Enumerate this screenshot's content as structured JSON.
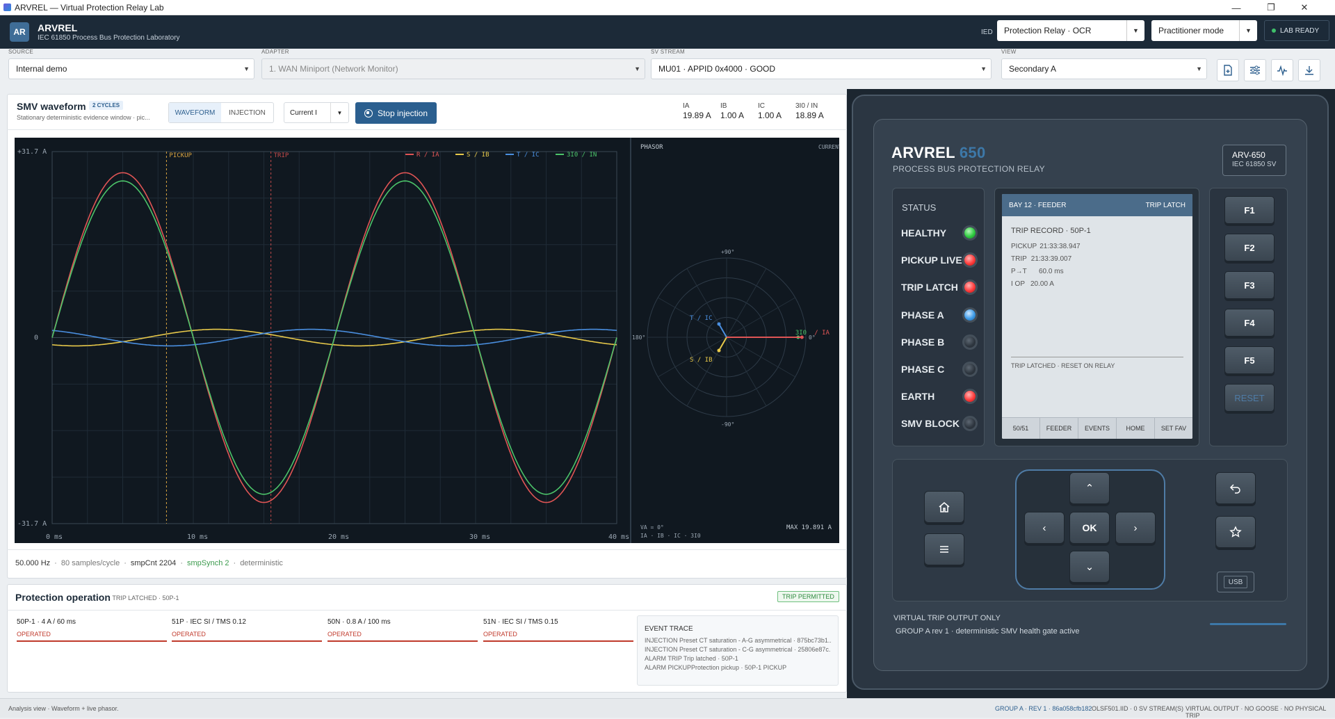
{
  "window": {
    "title": "ARVREL — Virtual Protection Relay Lab"
  },
  "header": {
    "logo": "AR",
    "brand": "ARVREL",
    "subtitle": "IEC 61850 Process Bus Protection Laboratory",
    "ied_label": "IED",
    "ied_value": "Protection Relay · OCR",
    "mode_value": "Practitioner mode",
    "status": "LAB READY"
  },
  "selectors": {
    "source": {
      "label": "SOURCE",
      "value": "Internal demo"
    },
    "adapter": {
      "label": "ADAPTER",
      "value": "1. WAN Miniport (Network Monitor)"
    },
    "sv_stream": {
      "label": "SV STREAM",
      "value": "MU01 · APPID 0x4000 · GOOD"
    },
    "view": {
      "label": "VIEW",
      "value": "Secondary A"
    }
  },
  "smv": {
    "title": "SMV waveform",
    "cycles_badge": "2 CYCLES",
    "subtitle": "Stationary deterministic evidence window · pic...",
    "tabs": [
      "WAVEFORM",
      "INJECTION"
    ],
    "active_tab": "WAVEFORM",
    "quantity": "Current I",
    "stop_button": "Stop injection",
    "measurements": [
      {
        "label": "IA",
        "value": "19.89 A"
      },
      {
        "label": "IB",
        "value": "1.00 A"
      },
      {
        "label": "IC",
        "value": "1.00 A"
      },
      {
        "label": "3I0 / IN",
        "value": "18.89 A"
      }
    ],
    "footer": {
      "freq": "50.000 Hz",
      "spc": "80 samples/cycle",
      "smpcnt": "smpCnt 2204",
      "synch": "smpSynch 2",
      "mode": "deterministic"
    }
  },
  "chart_data": [
    {
      "type": "line",
      "title": "",
      "ylabel_top": "+31.7 A",
      "ylabel_zero": "0",
      "ylabel_bottom": "-31.7 A",
      "x_unit": "ms",
      "xlim": [
        0,
        40
      ],
      "ylim": [
        -31.7,
        31.7
      ],
      "xticks": [
        "0 ms",
        "10 ms",
        "20 ms",
        "30 ms",
        "40 ms"
      ],
      "markers": [
        {
          "label": "PICKUP",
          "x": 8.1
        },
        {
          "label": "TRIP",
          "x": 15.5
        }
      ],
      "series": [
        {
          "name": "R / IA",
          "color": "#e05555",
          "amplitude": 28.1,
          "phase_deg": 0
        },
        {
          "name": "S / IB",
          "color": "#e8c94a",
          "amplitude": 1.41,
          "phase_deg": -120
        },
        {
          "name": "T / IC",
          "color": "#4a8fe0",
          "amplitude": 1.41,
          "phase_deg": 120
        },
        {
          "name": "3I0 / IN",
          "color": "#4cc46a",
          "amplitude": 26.7,
          "phase_deg": 0
        }
      ],
      "grid": true,
      "legend": "top-right"
    },
    {
      "type": "phasor",
      "title": "PHASOR",
      "tag": "CURRENT",
      "angle_labels": [
        "+90°",
        "180°",
        "0°",
        "-90°"
      ],
      "phasors": [
        {
          "name": "T / IC",
          "color": "#4a8fe0",
          "magnitude": 1.0,
          "angle_deg": 120
        },
        {
          "name": "S / IB",
          "color": "#e8c94a",
          "magnitude": 1.0,
          "angle_deg": -120
        },
        {
          "name": "3I0",
          "color": "#4cc46a",
          "magnitude": 18.89,
          "angle_deg": 0
        },
        {
          "name": "/ IA",
          "color": "#e05555",
          "magnitude": 19.89,
          "angle_deg": 0
        }
      ],
      "footer_left1": "VA = 0°",
      "footer_left2": "IA · IB · IC · 3I0",
      "footer_right": "MAX 19.891 A"
    }
  ],
  "protection": {
    "title": "Protection operation",
    "subtitle": "· TRIP LATCHED · 50P-1",
    "badge": "TRIP PERMITTED",
    "elements": [
      {
        "name": "50P-1 · 4 A / 60 ms",
        "status": "OPERATED"
      },
      {
        "name": "51P · IEC SI / TMS 0.12",
        "status": "OPERATED"
      },
      {
        "name": "50N · 0.8 A / 100 ms",
        "status": "OPERATED"
      },
      {
        "name": "51N · IEC SI / TMS 0.15",
        "status": "OPERATED"
      }
    ],
    "event_trace": {
      "title": "EVENT TRACE",
      "lines": [
        "INJECTION Preset CT saturation - A-G asymmetrical · 875bc73b1...",
        "INJECTION Preset CT saturation - C-G asymmetrical · 25806e87c...",
        "ALARM TRIP Trip latched · 50P-1",
        "ALARM PICKUPProtection pickup · 50P-1 PICKUP"
      ]
    }
  },
  "relay": {
    "brand": "ARVREL",
    "model_num": "650",
    "subtitle": "PROCESS BUS PROTECTION RELAY",
    "model_tag": "ARV-650",
    "model_tag_sub": "IEC 61850 SV",
    "status_title": "STATUS",
    "leds": [
      {
        "label": "HEALTHY",
        "color": "g"
      },
      {
        "label": "PICKUP LIVE",
        "color": "r"
      },
      {
        "label": "TRIP LATCH",
        "color": "r"
      },
      {
        "label": "PHASE A",
        "color": "b"
      },
      {
        "label": "PHASE B",
        "color": "o"
      },
      {
        "label": "PHASE C",
        "color": "o"
      },
      {
        "label": "EARTH",
        "color": "r"
      },
      {
        "label": "SMV BLOCK",
        "color": "o"
      }
    ],
    "screen": {
      "header_left": "BAY 12 · FEEDER",
      "header_right": "TRIP LATCH",
      "record_title": "TRIP RECORD · 50P-1",
      "lines": [
        {
          "k": "PICKUP",
          "v": "21:33:38.947"
        },
        {
          "k": "TRIP",
          "v": "21:33:39.007"
        },
        {
          "k": "P→T",
          "v": "60.0 ms"
        },
        {
          "k": "I OP",
          "v": "20.00 A"
        }
      ],
      "latched": "TRIP LATCHED · RESET ON RELAY",
      "tabs": [
        "50/51",
        "FEEDER",
        "EVENTS",
        "HOME",
        "SET FAV"
      ]
    },
    "fkeys": [
      "F1",
      "F2",
      "F3",
      "F4",
      "F5"
    ],
    "reset": "RESET",
    "ok": "OK",
    "usb": "USB",
    "footer1": "VIRTUAL TRIP OUTPUT ONLY",
    "footer2": "GROUP A rev 1 · deterministic SMV health gate active"
  },
  "statusbar": {
    "left": "Analysis view · Waveform + live phasor.",
    "r1": "GROUP A · REV 1 · 86a058cfb182",
    "r2": "OLSF501.IID · 0 SV STREAM(S)",
    "r3": "VIRTUAL OUTPUT · NO GOOSE · NO PHYSICAL TRIP"
  }
}
